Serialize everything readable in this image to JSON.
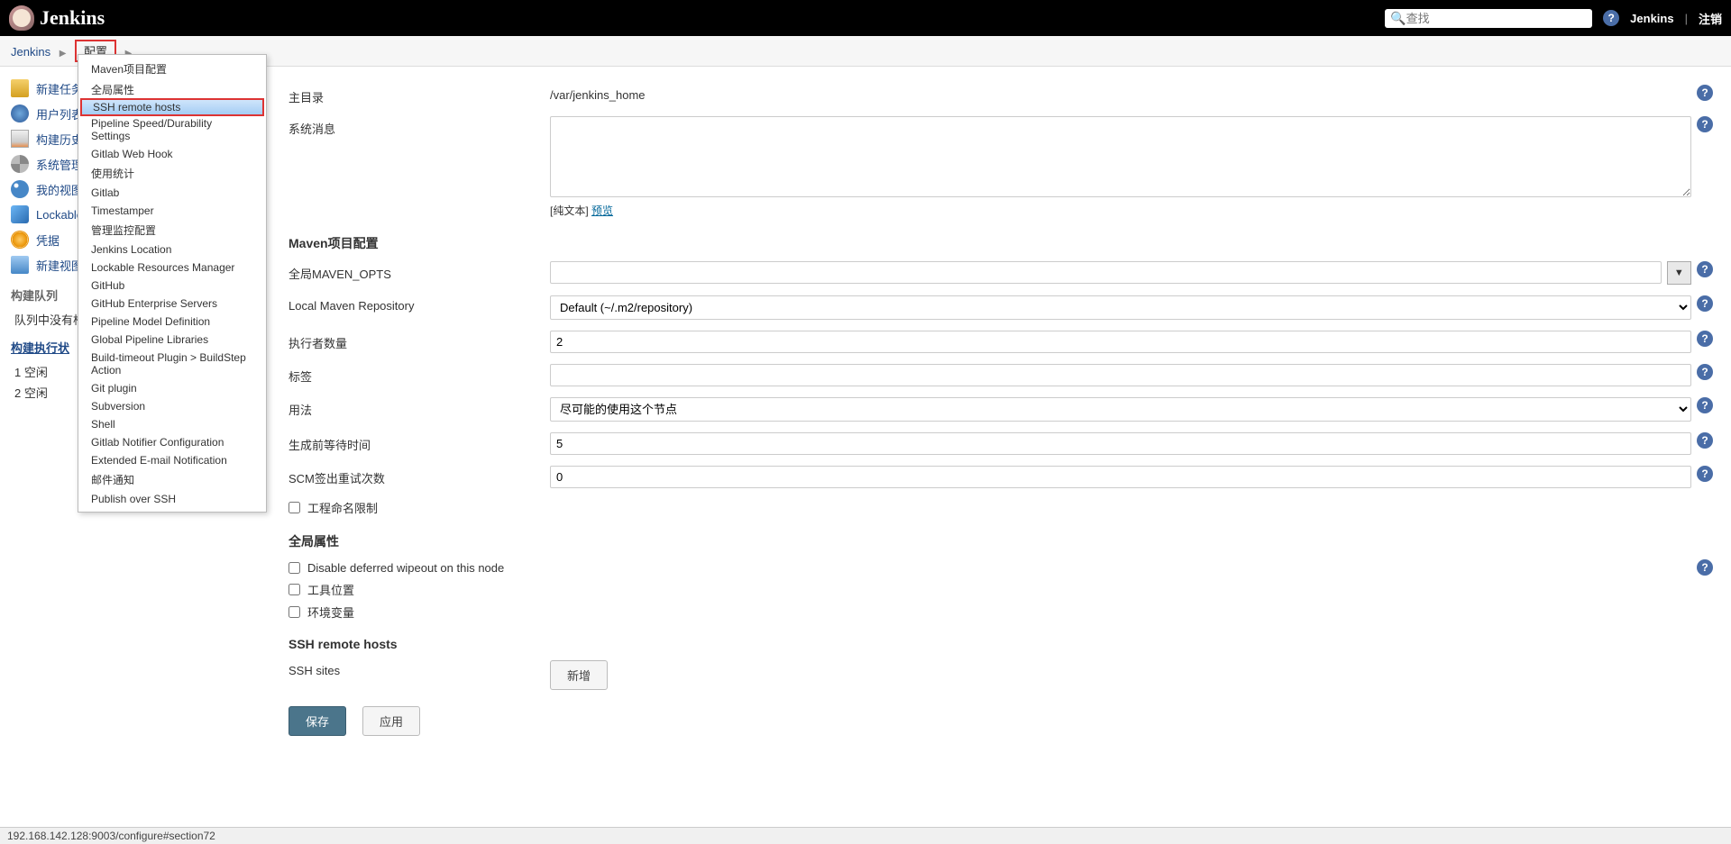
{
  "header": {
    "logo": "Jenkins",
    "search_placeholder": "查找",
    "link_jenkins": "Jenkins",
    "link_logout": "注销"
  },
  "breadcrumbs": {
    "root": "Jenkins",
    "current": "配置"
  },
  "sidebar": {
    "items": [
      {
        "label": "新建任务",
        "icon": "new"
      },
      {
        "label": "用户列表",
        "icon": "users"
      },
      {
        "label": "构建历史",
        "icon": "hist"
      },
      {
        "label": "系统管理",
        "icon": "sys"
      },
      {
        "label": "我的视图",
        "icon": "view"
      },
      {
        "label": "Lockable",
        "icon": "lock"
      },
      {
        "label": "凭据",
        "icon": "cred"
      },
      {
        "label": "新建视图",
        "icon": "folder"
      }
    ],
    "queue_head": "构建队列",
    "queue_empty": "队列中没有构",
    "exec_head": "构建执行状",
    "execs": [
      {
        "num": "1",
        "label": "空闲"
      },
      {
        "num": "2",
        "label": "空闲"
      }
    ]
  },
  "dropdown": {
    "items": [
      "Maven项目配置",
      "全局属性",
      "SSH remote hosts",
      "Pipeline Speed/Durability Settings",
      "Gitlab Web Hook",
      "使用统计",
      "Gitlab",
      "Timestamper",
      "管理监控配置",
      "Jenkins Location",
      "Lockable Resources Manager",
      "GitHub",
      "GitHub Enterprise Servers",
      "Pipeline Model Definition",
      "Global Pipeline Libraries",
      "Build-timeout Plugin > BuildStep Action",
      "Git plugin",
      "Subversion",
      "Shell",
      "Gitlab Notifier Configuration",
      "Extended E-mail Notification",
      "邮件通知",
      "Publish over SSH"
    ],
    "highlighted_index": 2
  },
  "form": {
    "home_dir_label": "主目录",
    "home_dir_value": "/var/jenkins_home",
    "sysmsg_label": "系统消息",
    "preview_plain": "[纯文本]",
    "preview_link": "预览",
    "maven_section": "Maven项目配置",
    "maven_opts_label": "全局MAVEN_OPTS",
    "maven_repo_label": "Local Maven Repository",
    "maven_repo_value": "Default (~/.m2/repository)",
    "executors_label": "执行者数量",
    "executors_value": "2",
    "labels_label": "标签",
    "usage_label": "用法",
    "usage_value": "尽可能的使用这个节点",
    "quiet_label": "生成前等待时间",
    "quiet_value": "5",
    "scm_label": "SCM签出重试次数",
    "scm_value": "0",
    "naming_label": "工程命名限制",
    "global_props_section": "全局属性",
    "disable_wipe_label": "Disable deferred wipeout on this node",
    "tool_loc_label": "工具位置",
    "env_label": "环境变量",
    "ssh_section": "SSH remote hosts",
    "ssh_sites_label": "SSH sites",
    "add_btn": "新增",
    "save_btn": "保存",
    "apply_btn": "应用"
  },
  "status_bar": "192.168.142.128:9003/configure#section72"
}
